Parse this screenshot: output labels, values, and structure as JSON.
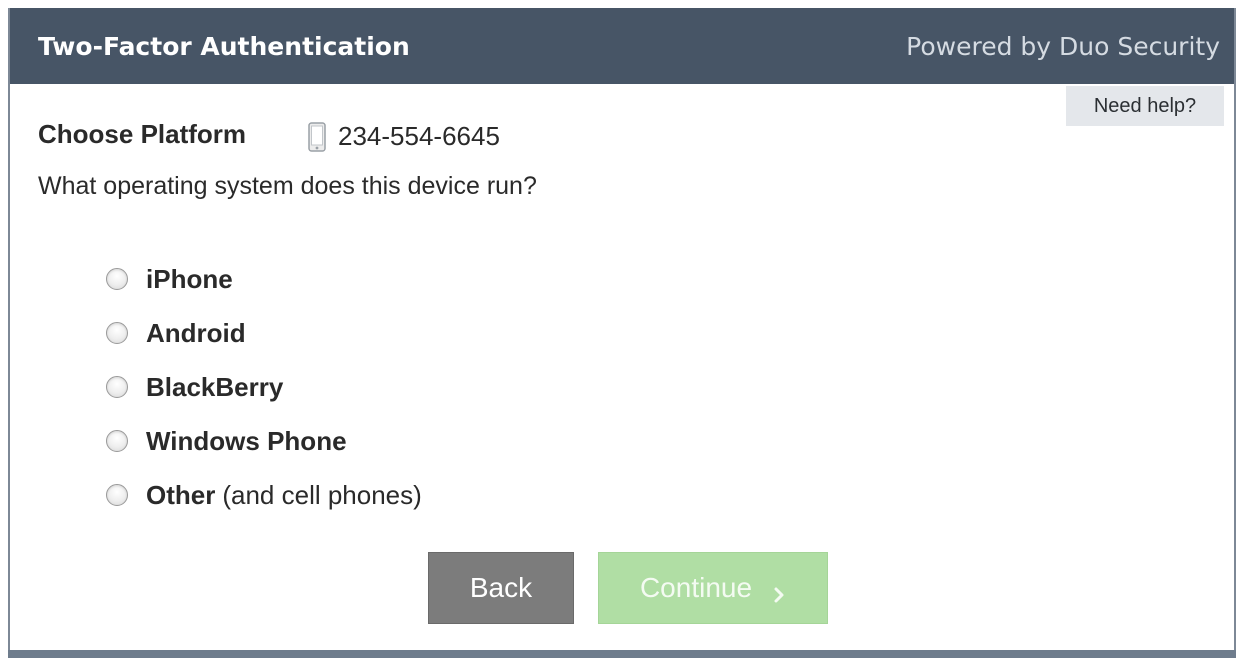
{
  "header": {
    "title": "Two-Factor Authentication",
    "powered_by": "Powered by Duo Security"
  },
  "help": {
    "label": "Need help?"
  },
  "platform": {
    "heading": "Choose Platform",
    "phone_icon": "mobile-phone-icon",
    "phone_number": "234-554-6645",
    "question": "What operating system does this device run?"
  },
  "options": [
    {
      "label": "iPhone",
      "suffix": ""
    },
    {
      "label": "Android",
      "suffix": ""
    },
    {
      "label": "BlackBerry",
      "suffix": ""
    },
    {
      "label": "Windows Phone",
      "suffix": ""
    },
    {
      "label": "Other",
      "suffix": "(and cell phones)"
    }
  ],
  "buttons": {
    "back": "Back",
    "continue": "Continue",
    "continue_icon": "chevron-right-icon"
  },
  "colors": {
    "header_bg": "#475566",
    "back_bg": "#7c7c7c",
    "continue_bg": "#b0dea4"
  }
}
